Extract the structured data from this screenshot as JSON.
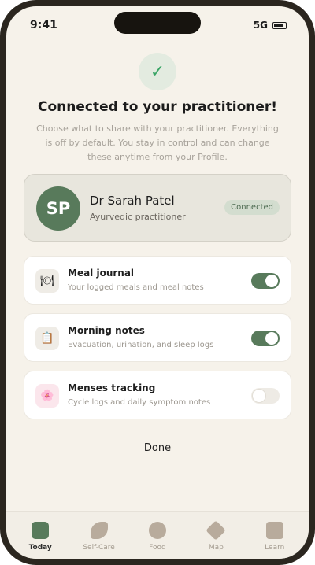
{
  "status_bar": {
    "time": "9:41",
    "network": "5G"
  },
  "header": {
    "check_glyph": "✓",
    "title": "Connected to your practitioner!",
    "subtitle": "Choose what to share with your practitioner. Everything is off by default. You stay in control and can change these anytime from your Profile."
  },
  "practitioner": {
    "initials": "SP",
    "name": "Dr Sarah Patel",
    "role": "Ayurvedic practitioner",
    "status": "Connected"
  },
  "share_items": [
    {
      "icon": "plate-icon",
      "glyph": "🍽",
      "title": "Meal journal",
      "description": "Your logged meals and meal notes",
      "enabled": true
    },
    {
      "icon": "clipboard-icon",
      "glyph": "📋",
      "title": "Morning notes",
      "description": "Evacuation, urination, and sleep logs",
      "enabled": true
    },
    {
      "icon": "flower-icon",
      "glyph": "🌸",
      "title": "Menses tracking",
      "description": "Cycle logs and daily symptom notes",
      "enabled": false
    }
  ],
  "done_label": "Done",
  "tabs": [
    {
      "label": "Today",
      "icon": "today-icon",
      "active": true
    },
    {
      "label": "Self-Care",
      "icon": "leaf-icon",
      "active": false
    },
    {
      "label": "Food",
      "icon": "food-icon",
      "active": false
    },
    {
      "label": "Map",
      "icon": "map-icon",
      "active": false
    },
    {
      "label": "Learn",
      "icon": "book-icon",
      "active": false
    }
  ],
  "colors": {
    "accent": "#587a5b",
    "success": "#3aa566",
    "background": "#f6f2ea"
  }
}
